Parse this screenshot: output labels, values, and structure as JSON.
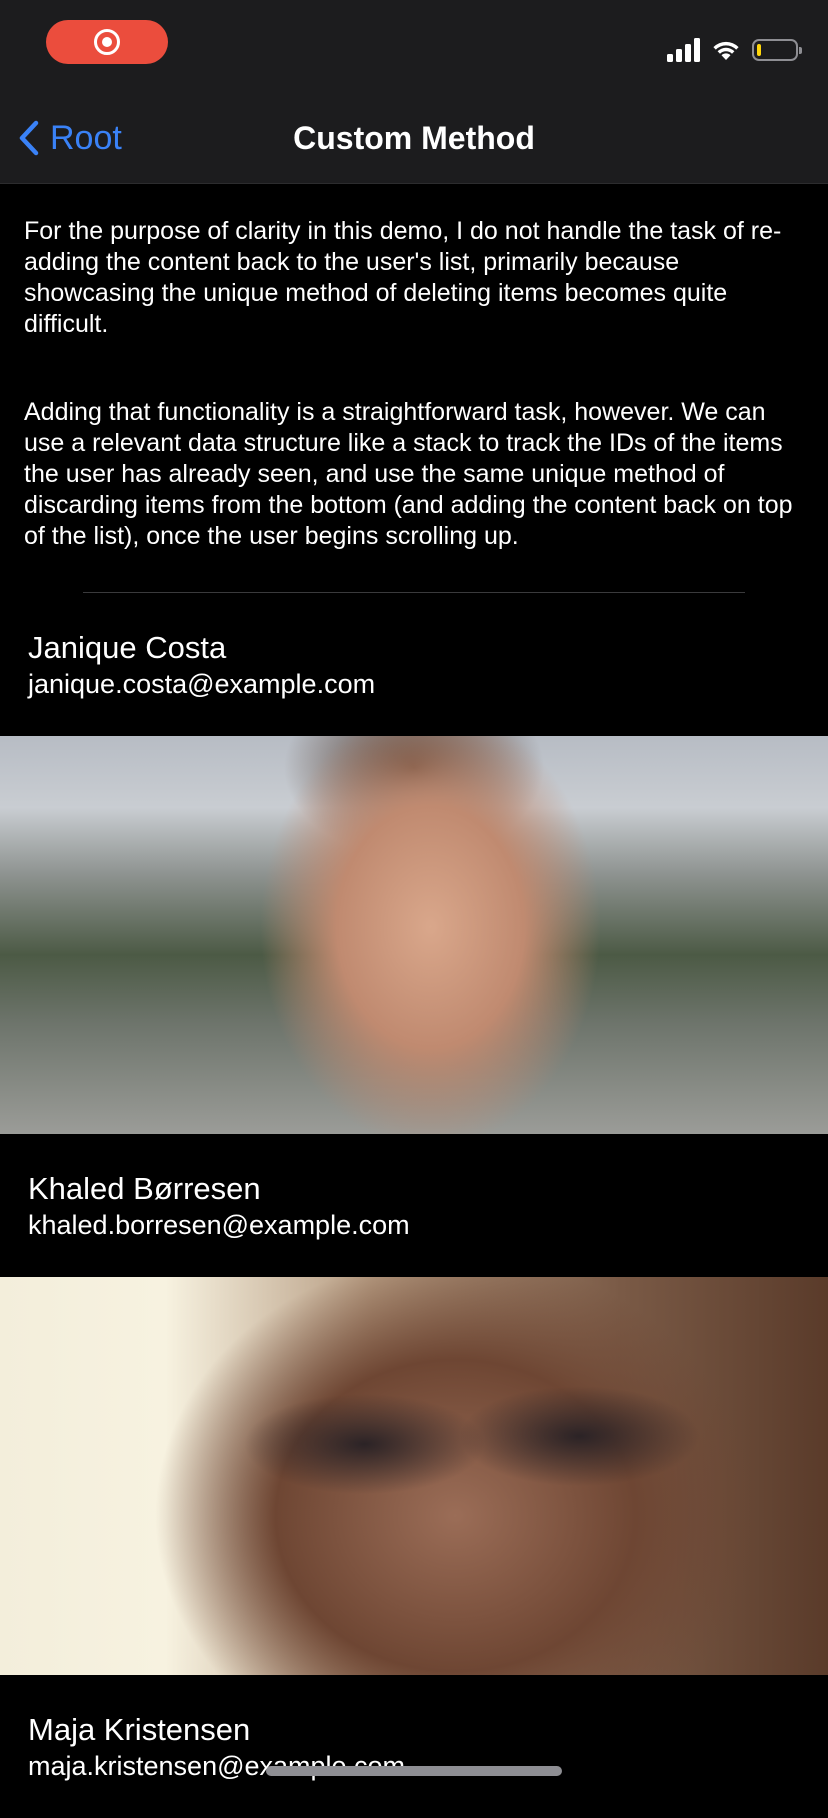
{
  "status_bar": {
    "recording_icon": "screen-recording-icon",
    "signal_icon": "cellular-signal-icon",
    "wifi_icon": "wifi-icon",
    "battery_icon": "battery-icon",
    "battery_level": 0.12,
    "colors": {
      "recording": "#eb4d3d",
      "battery_fill": "#ffd60a"
    }
  },
  "nav": {
    "back_label": "Root",
    "back_icon": "chevron-left-icon",
    "title": "Custom Method",
    "accent": "#3a82f7"
  },
  "intro": {
    "paragraph_1": "For the purpose of clarity in this demo, I do not handle the task of re-adding the content back to the user's list, primarily because showcasing the unique method of deleting items becomes quite difficult.",
    "paragraph_2": "Adding that functionality is a straightforward task, however. We can use a relevant data structure like a stack to track the IDs of the items the user has already seen, and use the same unique method of discarding items from the bottom (and adding the content back on top of the list), once the user begins scrolling up."
  },
  "users": [
    {
      "name": "Janique Costa",
      "email": "janique.costa@example.com"
    },
    {
      "name": "Khaled Børresen",
      "email": "khaled.borresen@example.com"
    },
    {
      "name": "Maja Kristensen",
      "email": "maja.kristensen@example.com"
    }
  ]
}
